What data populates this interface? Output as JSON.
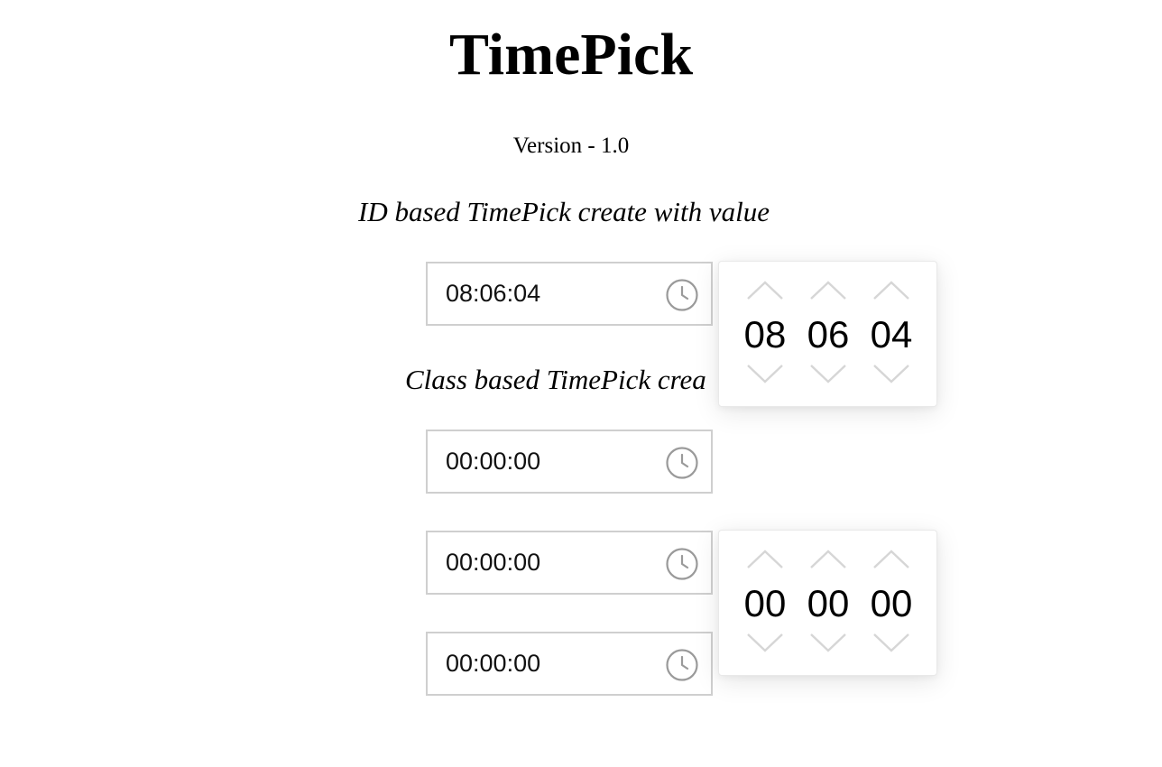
{
  "page": {
    "title": "TimePick",
    "version": "Version - 1.0"
  },
  "sections": {
    "id_heading": "ID based TimePick create with value",
    "class_heading": "Class based TimePick crea"
  },
  "inputs": [
    {
      "value": "08:06:04",
      "icon": "clock-icon"
    },
    {
      "value": "00:00:00",
      "icon": "clock-icon"
    },
    {
      "value": "00:00:00",
      "icon": "clock-icon"
    },
    {
      "value": "00:00:00",
      "icon": "clock-icon"
    }
  ],
  "pickers": [
    {
      "hours": "08",
      "minutes": "06",
      "seconds": "04"
    },
    {
      "hours": "00",
      "minutes": "00",
      "seconds": "00"
    }
  ],
  "colors": {
    "border": "#cfcfcf",
    "icon": "#9a9a9a",
    "arrow": "#d6d6d6"
  }
}
